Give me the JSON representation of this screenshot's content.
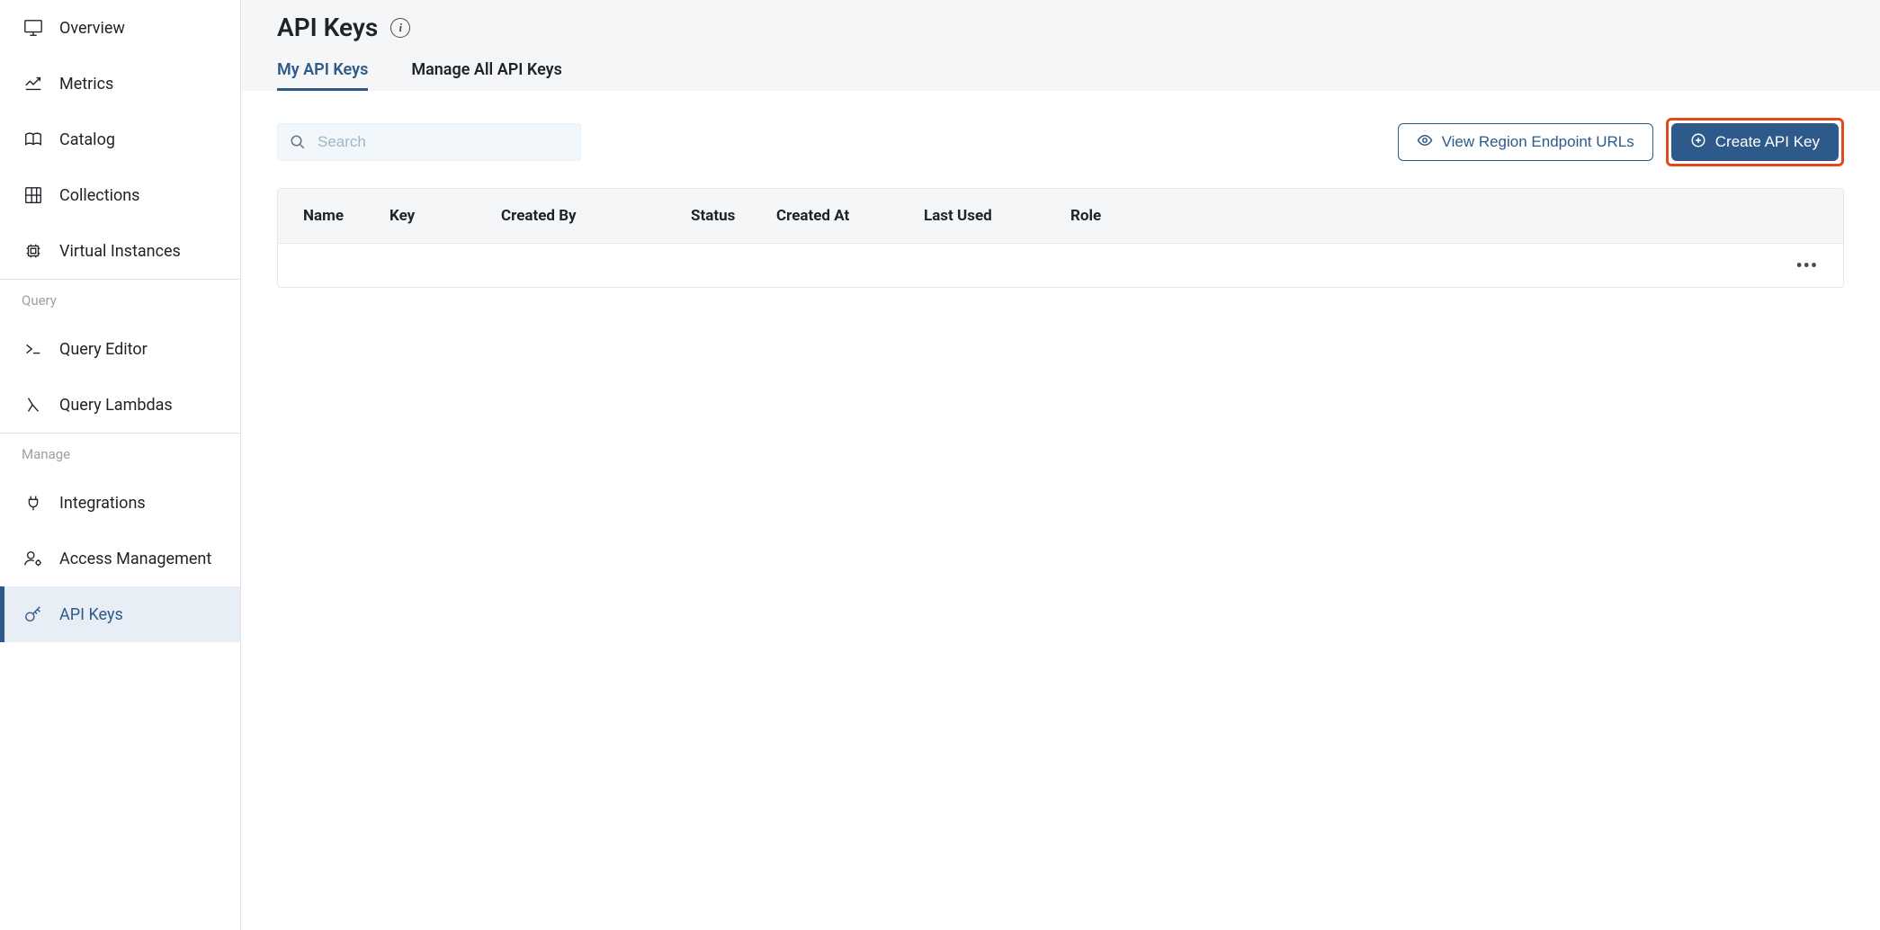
{
  "sidebar": {
    "top_items": [
      {
        "label": "Overview",
        "icon": "monitor"
      },
      {
        "label": "Metrics",
        "icon": "chart"
      },
      {
        "label": "Catalog",
        "icon": "book"
      },
      {
        "label": "Collections",
        "icon": "grid"
      },
      {
        "label": "Virtual Instances",
        "icon": "chip"
      }
    ],
    "section_query": {
      "header": "Query",
      "items": [
        {
          "label": "Query Editor",
          "icon": "terminal"
        },
        {
          "label": "Query Lambdas",
          "icon": "lambda"
        }
      ]
    },
    "section_manage": {
      "header": "Manage",
      "items": [
        {
          "label": "Integrations",
          "icon": "plug"
        },
        {
          "label": "Access Management",
          "icon": "users-gear"
        },
        {
          "label": "API Keys",
          "icon": "key",
          "active": true
        }
      ]
    }
  },
  "header": {
    "title": "API Keys",
    "tabs": [
      {
        "label": "My API Keys",
        "active": true
      },
      {
        "label": "Manage All API Keys",
        "active": false
      }
    ]
  },
  "toolbar": {
    "search_placeholder": "Search",
    "view_urls_label": "View Region Endpoint URLs",
    "create_key_label": "Create API Key"
  },
  "table": {
    "columns": {
      "name": "Name",
      "key": "Key",
      "created_by": "Created By",
      "status": "Status",
      "created_at": "Created At",
      "last_used": "Last Used",
      "role": "Role"
    },
    "rows": []
  }
}
